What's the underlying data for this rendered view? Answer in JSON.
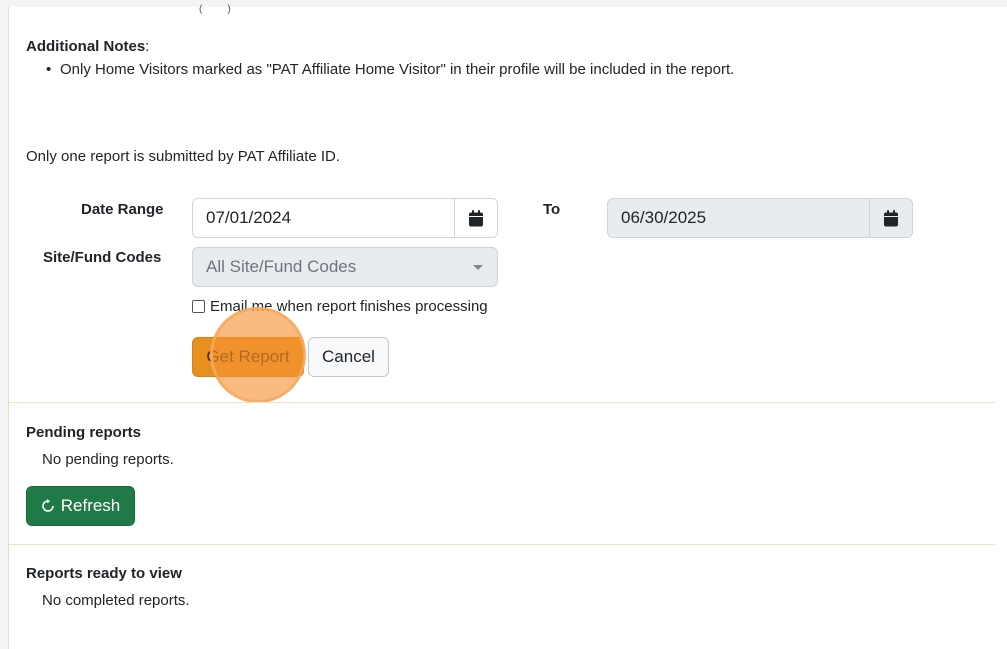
{
  "notes": {
    "title": "Additional Notes",
    "colon": ":",
    "items": [
      "Only Home Visitors marked as \"PAT Affiliate Home Visitor\" in their profile will be included in the report."
    ]
  },
  "info_text": "Only one report is submitted by PAT Affiliate ID.",
  "form": {
    "date_range_label": "Date Range",
    "start_date": "07/01/2024",
    "to_label": "To",
    "end_date": "06/30/2025",
    "site_fund_label": "Site/Fund Codes",
    "site_fund_selected": "All Site/Fund Codes",
    "email_checkbox_label": "Email me when report finishes processing",
    "email_checked": false,
    "get_report_label": "Get Report",
    "cancel_label": "Cancel"
  },
  "pending": {
    "title": "Pending reports",
    "empty_text": "No pending reports.",
    "refresh_label": "Refresh"
  },
  "ready": {
    "title": "Reports ready to view",
    "empty_text": "No completed reports."
  },
  "colors": {
    "primary_orange": "#e8901e",
    "success_green": "#1f7a48",
    "click_highlight": "#f79234"
  },
  "icons": [
    "calendar-icon",
    "chevron-down-icon",
    "refresh-icon"
  ]
}
